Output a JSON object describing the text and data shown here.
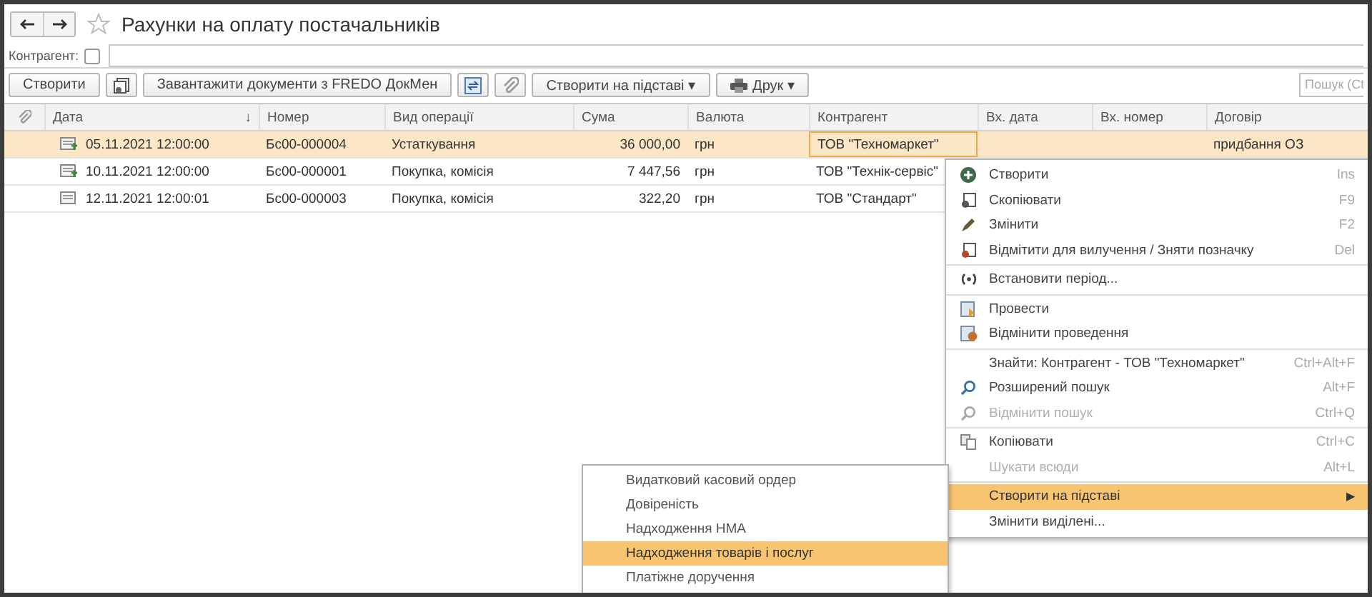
{
  "window": {
    "title": "Рахунки на оплату постачальників"
  },
  "filter": {
    "label": "Контрагент:",
    "checked": false
  },
  "toolbar": {
    "buttons": [
      {
        "kind": "text",
        "label": "Створити"
      },
      {
        "kind": "copy-icon"
      },
      {
        "kind": "text",
        "label": "Завантажити документи з FREDO ДокМен"
      },
      {
        "kind": "sync-icon"
      },
      {
        "kind": "clip-icon"
      },
      {
        "kind": "dropdown",
        "label": "Створити на підставі ▾"
      },
      {
        "kind": "print",
        "label": "Друк ▾"
      }
    ],
    "search": {
      "placeholder": "Пошук (Ct"
    }
  },
  "table": {
    "columns": [
      "Дата",
      "Номер",
      "Вид операції",
      "Сума",
      "Валюта",
      "Контрагент",
      "Вх. дата",
      "Вх. номер",
      "Договір"
    ],
    "sort_mark": "↓",
    "rows": [
      {
        "selected": true,
        "posted": true,
        "cells": [
          "05.11.2021 12:00:00",
          "Бс00-000004",
          "Устаткування",
          "36 000,00",
          "грн",
          "ТОВ \"Техномаркет\"",
          "",
          "",
          "придбання ОЗ"
        ]
      },
      {
        "selected": false,
        "posted": true,
        "cells": [
          "10.11.2021 12:00:00",
          "Бс00-000001",
          "Покупка, комісія",
          "7 447,56",
          "грн",
          "ТОВ \"Технік-сервіс\"",
          "",
          "",
          ""
        ]
      },
      {
        "selected": false,
        "posted": false,
        "cells": [
          "12.11.2021 12:00:01",
          "Бс00-000003",
          "Покупка, комісія",
          "322,20",
          "грн",
          "ТОВ \"Стандарт\"",
          "",
          "",
          ""
        ]
      }
    ]
  },
  "context_menu": {
    "groups": [
      [
        {
          "kind": "add",
          "label": "Створити",
          "shortcut": "Ins",
          "disabled": false,
          "selected": false
        },
        {
          "kind": "copy",
          "label": "Скопіювати",
          "shortcut": "F9",
          "disabled": false,
          "selected": false
        },
        {
          "kind": "edit",
          "label": "Змінити",
          "shortcut": "F2",
          "disabled": false,
          "selected": false
        },
        {
          "kind": "delete",
          "label": "Відмітити для вилучення / Зняти позначку",
          "shortcut": "Del",
          "disabled": false,
          "selected": false
        }
      ],
      [
        {
          "kind": "period",
          "label": "Встановити період...",
          "disabled": false,
          "selected": false
        }
      ],
      [
        {
          "kind": "post",
          "label": "Провести",
          "disabled": false,
          "selected": false
        },
        {
          "kind": "unpost",
          "label": "Відмінити проведення",
          "disabled": false,
          "selected": false
        }
      ],
      [
        {
          "kind": "plain",
          "label": "Знайти: Контрагент - ТОВ \"Техномаркет\"",
          "shortcut": "Ctrl+Alt+F",
          "disabled": false,
          "selected": false
        },
        {
          "kind": "search",
          "label": "Розширений пошук",
          "shortcut": "Alt+F",
          "disabled": false,
          "selected": false
        },
        {
          "kind": "search",
          "label": "Відмінити пошук",
          "shortcut": "Ctrl+Q",
          "disabled": true,
          "selected": false
        }
      ],
      [
        {
          "kind": "clipboard",
          "label": "Копіювати",
          "shortcut": "Ctrl+C",
          "disabled": false,
          "selected": false
        },
        {
          "kind": "plain",
          "label": "Шукати всюди",
          "shortcut": "Alt+L",
          "disabled": true,
          "selected": false
        }
      ],
      [
        {
          "kind": "submenu",
          "label": "Створити на підставі",
          "submenu_mark": "▶",
          "disabled": false,
          "selected": true
        },
        {
          "kind": "plain",
          "label": "Змінити виділені...",
          "disabled": false,
          "selected": false
        }
      ]
    ]
  },
  "submenu": {
    "items": [
      {
        "label": "Видатковий касовий ордер",
        "selected": false
      },
      {
        "label": "Довіреність",
        "selected": false
      },
      {
        "label": "Надходження НМА",
        "selected": false
      },
      {
        "label": "Надходження товарів і послуг",
        "selected": true
      },
      {
        "label": "Платіжне доручення",
        "selected": false
      }
    ]
  }
}
